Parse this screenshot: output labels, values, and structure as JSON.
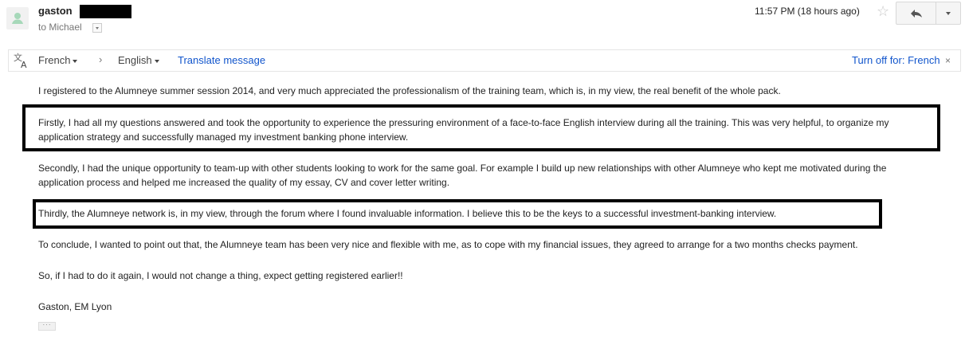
{
  "header": {
    "sender_name": "gaston",
    "recipient": "to Michael",
    "timestamp": "11:57 PM (18 hours ago)"
  },
  "translate_bar": {
    "source_language": "French",
    "target_language": "English",
    "translate_link": "Translate message",
    "turn_off_link": "Turn off for: French",
    "close_glyph": "×"
  },
  "body": {
    "paragraphs": [
      "I registered to the Alumneye summer session 2014, and very much appreciated the professionalism of the training team, which is, in my view, the real benefit of the whole pack.",
      "Firstly, I had all my questions answered and took the opportunity to experience the pressuring environment of a face-to-face English interview during all the training. This was very helpful, to organize my application strategy and successfully managed my investment banking phone interview.",
      "Secondly, I had the unique opportunity to team-up with other students looking to work for the same goal. For example I build up new relationships with other Alumneye who  kept me motivated during the application process and helped me increased the quality of my essay, CV and cover letter writing.",
      "Thirdly, the Alumneye network is, in my view, through the forum where I found invaluable information. I believe this to be the keys to a successful investment-banking interview.",
      "To conclude, I wanted to point out that, the Alumneye team has been very nice and flexible with me, as to cope with my financial issues, they agreed to arrange for a two months checks payment.",
      "So, if I had to do it again, I would not change a thing, expect getting registered earlier!!",
      "Gaston, EM Lyon"
    ],
    "ellipsis": "···"
  },
  "icons": {
    "avatar": "person-avatar-icon",
    "star": "star-icon",
    "reply": "reply-arrow-icon",
    "more": "chevron-down-icon",
    "translate": "translate-icon"
  },
  "colors": {
    "link": "#1155cc",
    "highlight_box": "#000000"
  }
}
